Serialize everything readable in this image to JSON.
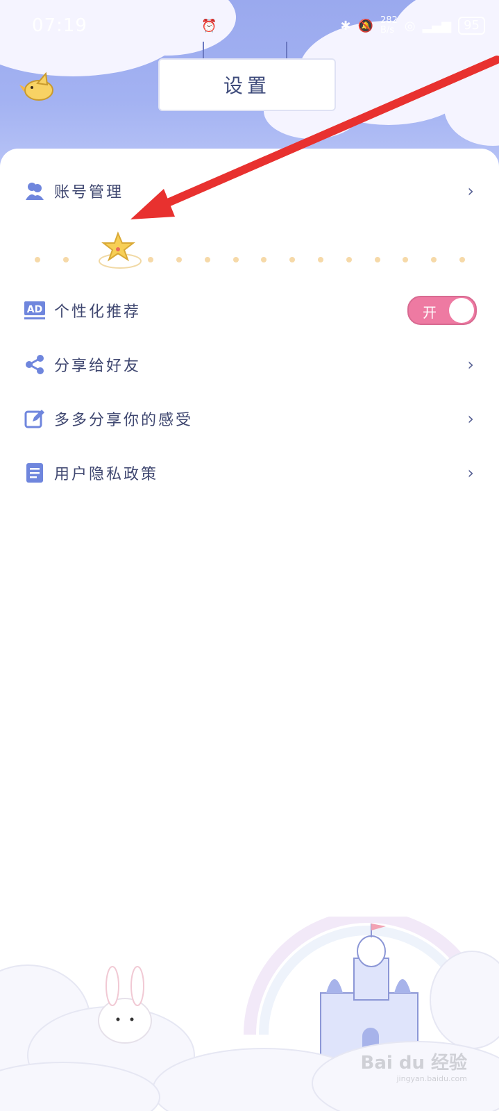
{
  "status_bar": {
    "time": "07:19",
    "net_speed_value": "282",
    "net_speed_unit": "B/s",
    "battery": "95",
    "icons": [
      "alarm-icon",
      "bluetooth-icon",
      "mute-icon",
      "hotspot-icon",
      "signal-icon"
    ]
  },
  "header": {
    "title": "设置"
  },
  "menu": {
    "account": {
      "label": "账号管理",
      "icon": "account-icon"
    },
    "personalized": {
      "label": "个性化推荐",
      "icon": "ad-icon",
      "toggle_label": "开",
      "toggle_on": true
    },
    "share": {
      "label": "分享给好友",
      "icon": "share-icon"
    },
    "feedback": {
      "label": "多多分享你的感受",
      "icon": "edit-icon"
    },
    "privacy": {
      "label": "用户隐私政策",
      "icon": "document-icon"
    }
  },
  "colors": {
    "header_bg": "#9aa9ee",
    "toggle_on": "#ee7aa2",
    "icon_blue": "#6f86dd",
    "arrow_red": "#e8312f"
  },
  "watermark": {
    "brand": "Bai du 经验",
    "url": "jingyan.baidu.com"
  }
}
